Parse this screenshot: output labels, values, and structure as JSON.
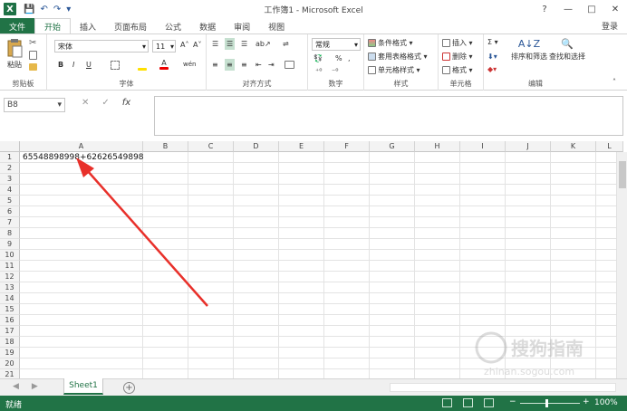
{
  "window": {
    "title": "工作簿1 - Microsoft Excel",
    "app_icon": "X",
    "help": "?",
    "minimize": "—",
    "restore": "□",
    "close": "✕"
  },
  "qat": {
    "save": "💾",
    "undo": "↶",
    "redo": "↷",
    "customize": "▾"
  },
  "tabs": [
    "文件",
    "开始",
    "插入",
    "页面布局",
    "公式",
    "数据",
    "审阅",
    "视图"
  ],
  "active_tab": "开始",
  "login": "登录",
  "ribbon": {
    "clipboard": {
      "label": "剪贴板",
      "paste": "粘贴"
    },
    "font": {
      "label": "字体",
      "name": "宋体",
      "size": "11",
      "grow": "A˄",
      "shrink": "A˅",
      "bold": "B",
      "italic": "I",
      "underline": "U",
      "font_color_letter": "A",
      "phonetic": "wén"
    },
    "alignment": {
      "label": "对齐方式"
    },
    "number": {
      "label": "数字",
      "format": "常规",
      "percent": "%",
      "comma": ","
    },
    "styles": {
      "label": "样式",
      "conditional": "条件格式 ▾",
      "table": "套用表格格式 ▾",
      "cell_styles": "单元格样式 ▾"
    },
    "cells": {
      "label": "单元格",
      "insert": "插入 ▾",
      "delete": "删除 ▾",
      "format": "格式 ▾"
    },
    "editing": {
      "label": "编辑",
      "sum": "Σ ▾",
      "sort": "排序和筛选",
      "find": "查找和选择"
    }
  },
  "formula_bar": {
    "name_box": "B8",
    "cancel": "✕",
    "enter": "✓",
    "fx": "fx",
    "value": ""
  },
  "grid": {
    "columns": [
      "A",
      "B",
      "C",
      "D",
      "E",
      "F",
      "G",
      "H",
      "I",
      "J",
      "K",
      "L"
    ],
    "rows": [
      "1",
      "2",
      "3",
      "4",
      "5",
      "6",
      "7",
      "8",
      "9",
      "10",
      "11",
      "12",
      "13",
      "14",
      "15",
      "16",
      "17",
      "18",
      "19",
      "20",
      "21"
    ],
    "a1_value": "65548898998+62626549898"
  },
  "sheets": {
    "tabs": [
      "Sheet1"
    ],
    "active": "Sheet1",
    "add": "+",
    "prev": "◀",
    "next": "▶"
  },
  "status": {
    "text": "就绪",
    "zoom_minus": "−",
    "zoom_plus": "+",
    "zoom_level": "100%"
  },
  "watermark": {
    "text": "搜狗指南",
    "subtext": "zhinan.sogou.com"
  },
  "colors": {
    "brand_green": "#217346",
    "arrow_red": "#e8302a"
  }
}
